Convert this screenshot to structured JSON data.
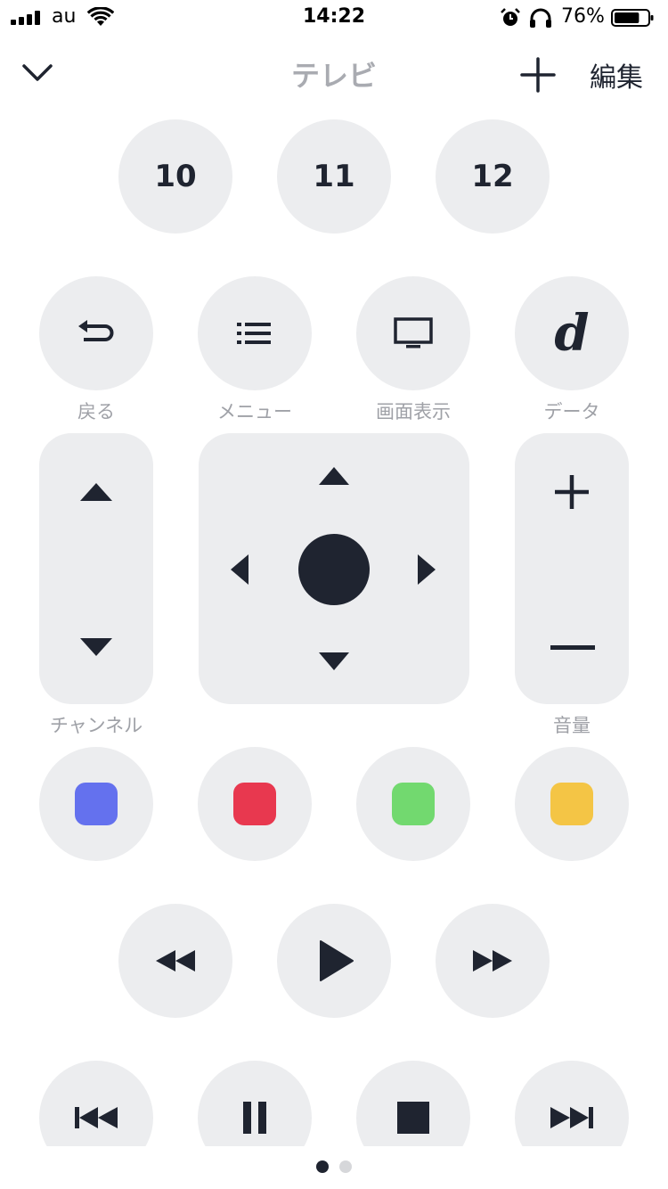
{
  "status_bar": {
    "carrier": "au",
    "time": "14:22",
    "battery_percent": "76%",
    "battery_level": 0.76,
    "icons": [
      "signal-icon",
      "wifi-icon",
      "alarm-icon",
      "headphones-icon",
      "battery-icon"
    ]
  },
  "nav": {
    "title": "テレビ",
    "edit_label": "編集",
    "icons": [
      "chevron-down-icon",
      "plus-icon"
    ]
  },
  "channels": [
    "10",
    "11",
    "12"
  ],
  "function_buttons": {
    "back": "戻る",
    "menu": "メニュー",
    "screen_display": "画面表示",
    "data": "データ",
    "data_glyph": "d"
  },
  "controls": {
    "channel_label": "チャンネル",
    "volume_label": "音量"
  },
  "color_buttons": {
    "colors": [
      "#6471ee",
      "#e8384f",
      "#72d96f",
      "#f4c545"
    ]
  },
  "page_indicator": {
    "current": 1,
    "total": 2
  }
}
